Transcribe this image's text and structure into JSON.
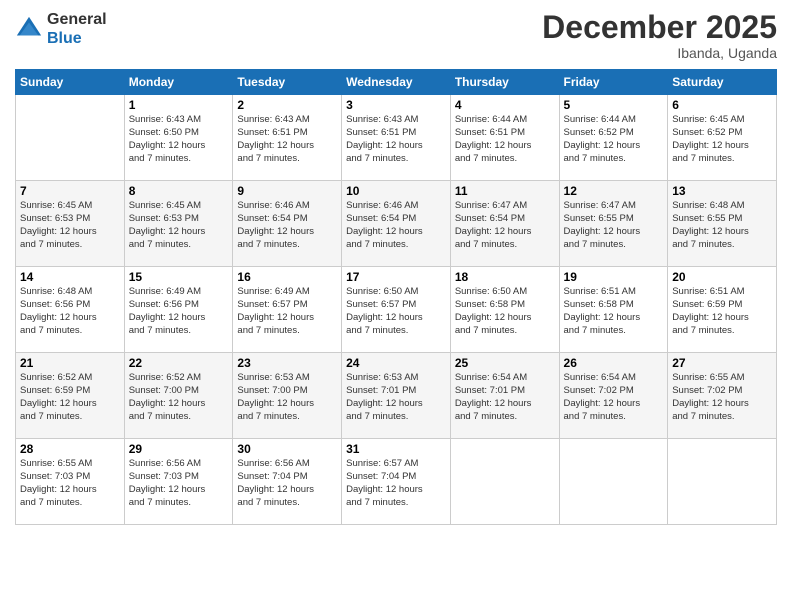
{
  "header": {
    "logo_line1": "General",
    "logo_line2": "Blue",
    "month": "December 2025",
    "location": "Ibanda, Uganda"
  },
  "days_of_week": [
    "Sunday",
    "Monday",
    "Tuesday",
    "Wednesday",
    "Thursday",
    "Friday",
    "Saturday"
  ],
  "weeks": [
    [
      {
        "day": "",
        "info": ""
      },
      {
        "day": "1",
        "info": "Sunrise: 6:43 AM\nSunset: 6:50 PM\nDaylight: 12 hours\nand 7 minutes."
      },
      {
        "day": "2",
        "info": "Sunrise: 6:43 AM\nSunset: 6:51 PM\nDaylight: 12 hours\nand 7 minutes."
      },
      {
        "day": "3",
        "info": "Sunrise: 6:43 AM\nSunset: 6:51 PM\nDaylight: 12 hours\nand 7 minutes."
      },
      {
        "day": "4",
        "info": "Sunrise: 6:44 AM\nSunset: 6:51 PM\nDaylight: 12 hours\nand 7 minutes."
      },
      {
        "day": "5",
        "info": "Sunrise: 6:44 AM\nSunset: 6:52 PM\nDaylight: 12 hours\nand 7 minutes."
      },
      {
        "day": "6",
        "info": "Sunrise: 6:45 AM\nSunset: 6:52 PM\nDaylight: 12 hours\nand 7 minutes."
      }
    ],
    [
      {
        "day": "7",
        "info": "Sunrise: 6:45 AM\nSunset: 6:53 PM\nDaylight: 12 hours\nand 7 minutes."
      },
      {
        "day": "8",
        "info": "Sunrise: 6:45 AM\nSunset: 6:53 PM\nDaylight: 12 hours\nand 7 minutes."
      },
      {
        "day": "9",
        "info": "Sunrise: 6:46 AM\nSunset: 6:54 PM\nDaylight: 12 hours\nand 7 minutes."
      },
      {
        "day": "10",
        "info": "Sunrise: 6:46 AM\nSunset: 6:54 PM\nDaylight: 12 hours\nand 7 minutes."
      },
      {
        "day": "11",
        "info": "Sunrise: 6:47 AM\nSunset: 6:54 PM\nDaylight: 12 hours\nand 7 minutes."
      },
      {
        "day": "12",
        "info": "Sunrise: 6:47 AM\nSunset: 6:55 PM\nDaylight: 12 hours\nand 7 minutes."
      },
      {
        "day": "13",
        "info": "Sunrise: 6:48 AM\nSunset: 6:55 PM\nDaylight: 12 hours\nand 7 minutes."
      }
    ],
    [
      {
        "day": "14",
        "info": "Sunrise: 6:48 AM\nSunset: 6:56 PM\nDaylight: 12 hours\nand 7 minutes."
      },
      {
        "day": "15",
        "info": "Sunrise: 6:49 AM\nSunset: 6:56 PM\nDaylight: 12 hours\nand 7 minutes."
      },
      {
        "day": "16",
        "info": "Sunrise: 6:49 AM\nSunset: 6:57 PM\nDaylight: 12 hours\nand 7 minutes."
      },
      {
        "day": "17",
        "info": "Sunrise: 6:50 AM\nSunset: 6:57 PM\nDaylight: 12 hours\nand 7 minutes."
      },
      {
        "day": "18",
        "info": "Sunrise: 6:50 AM\nSunset: 6:58 PM\nDaylight: 12 hours\nand 7 minutes."
      },
      {
        "day": "19",
        "info": "Sunrise: 6:51 AM\nSunset: 6:58 PM\nDaylight: 12 hours\nand 7 minutes."
      },
      {
        "day": "20",
        "info": "Sunrise: 6:51 AM\nSunset: 6:59 PM\nDaylight: 12 hours\nand 7 minutes."
      }
    ],
    [
      {
        "day": "21",
        "info": "Sunrise: 6:52 AM\nSunset: 6:59 PM\nDaylight: 12 hours\nand 7 minutes."
      },
      {
        "day": "22",
        "info": "Sunrise: 6:52 AM\nSunset: 7:00 PM\nDaylight: 12 hours\nand 7 minutes."
      },
      {
        "day": "23",
        "info": "Sunrise: 6:53 AM\nSunset: 7:00 PM\nDaylight: 12 hours\nand 7 minutes."
      },
      {
        "day": "24",
        "info": "Sunrise: 6:53 AM\nSunset: 7:01 PM\nDaylight: 12 hours\nand 7 minutes."
      },
      {
        "day": "25",
        "info": "Sunrise: 6:54 AM\nSunset: 7:01 PM\nDaylight: 12 hours\nand 7 minutes."
      },
      {
        "day": "26",
        "info": "Sunrise: 6:54 AM\nSunset: 7:02 PM\nDaylight: 12 hours\nand 7 minutes."
      },
      {
        "day": "27",
        "info": "Sunrise: 6:55 AM\nSunset: 7:02 PM\nDaylight: 12 hours\nand 7 minutes."
      }
    ],
    [
      {
        "day": "28",
        "info": "Sunrise: 6:55 AM\nSunset: 7:03 PM\nDaylight: 12 hours\nand 7 minutes."
      },
      {
        "day": "29",
        "info": "Sunrise: 6:56 AM\nSunset: 7:03 PM\nDaylight: 12 hours\nand 7 minutes."
      },
      {
        "day": "30",
        "info": "Sunrise: 6:56 AM\nSunset: 7:04 PM\nDaylight: 12 hours\nand 7 minutes."
      },
      {
        "day": "31",
        "info": "Sunrise: 6:57 AM\nSunset: 7:04 PM\nDaylight: 12 hours\nand 7 minutes."
      },
      {
        "day": "",
        "info": ""
      },
      {
        "day": "",
        "info": ""
      },
      {
        "day": "",
        "info": ""
      }
    ]
  ]
}
